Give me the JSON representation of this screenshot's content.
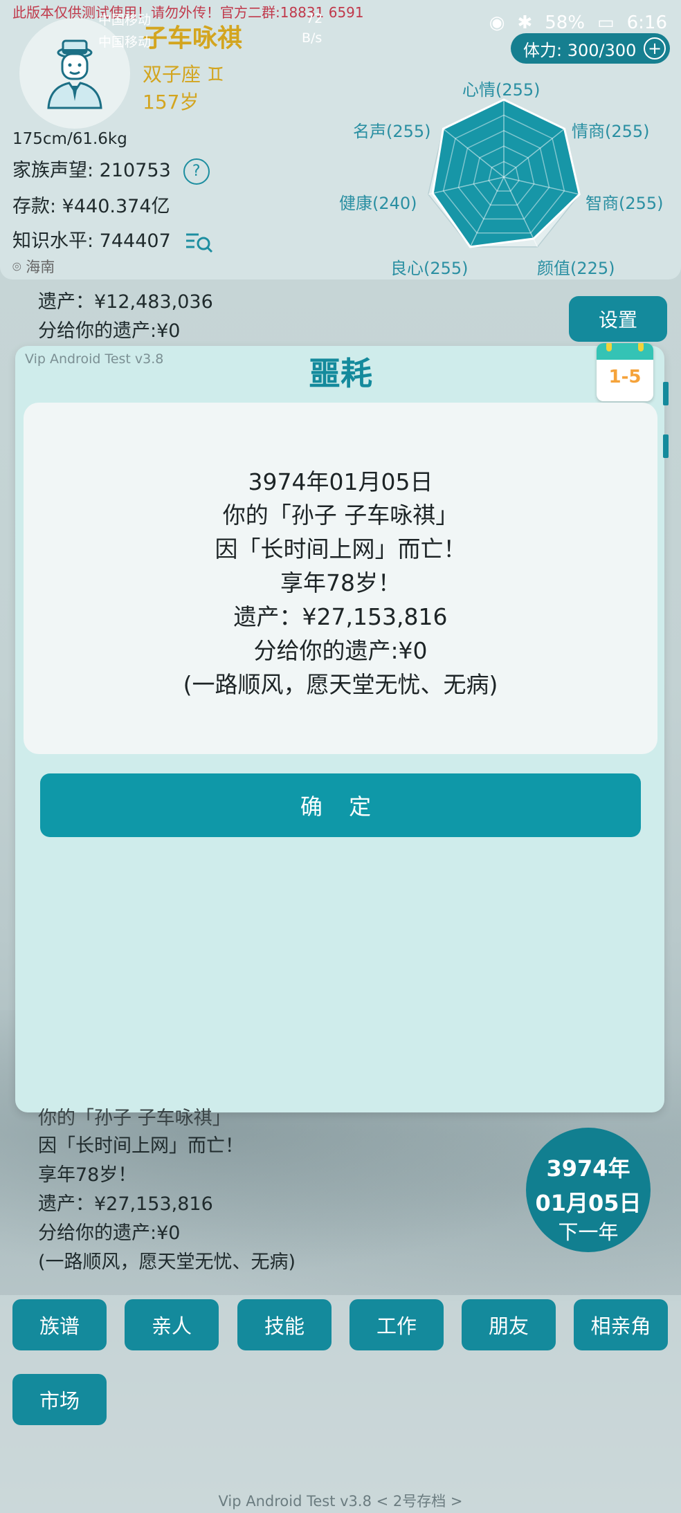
{
  "status_bar": {
    "watermark": "此版本仅供测试使用！请勿外传！官方二群:18831 6591",
    "carrier_1": "中国移动",
    "carrier_2": "中国移动",
    "net_speed": "72",
    "net_unit": "B/s",
    "battery": "58%",
    "time": "6:16"
  },
  "header": {
    "app_title": "子车咏祺",
    "zodiac": "双子座",
    "age": "157岁",
    "height_weight": "175cm/61.6kg",
    "family_reputation": "家族声望: 210753",
    "savings": "存款: ¥440.374亿",
    "knowledge": "知识水平: 744407",
    "location": "海南",
    "stamina": "体力: 300/300"
  },
  "radar": {
    "labels": [
      "心情(255)",
      "情商(255)",
      "智商(255)",
      "颜值(225)",
      "良心(255)",
      "健康(240)",
      "名声(255)"
    ],
    "values": [
      255,
      255,
      255,
      225,
      255,
      240,
      255
    ],
    "max": 255,
    "fill_color": "#1796a7"
  },
  "background_log": {
    "top_lines": [
      "遗产：¥12,483,036",
      "分给你的遗产:¥0"
    ],
    "bottom_lines": [
      "你的「孙子 子车咏祺」",
      "因「长时间上网」而亡！",
      "享年78岁！",
      "遗产：¥27,153,816",
      "分给你的遗产:¥0",
      "(一路顺风，愿天堂无忧、无病)"
    ]
  },
  "settings_label": "设置",
  "modal": {
    "version": "Vip Android Test v3.8",
    "title": "噩耗",
    "calendar": "1-5",
    "lines": [
      "3974年01月05日",
      "你的「孙子 子车咏祺」",
      "因「长时间上网」而亡！",
      "享年78岁！",
      "遗产：¥27,153,816",
      "分给你的遗产:¥0",
      "(一路顺风，愿天堂无忧、无病)"
    ],
    "confirm": "确 定"
  },
  "date_circle": {
    "year": "3974年",
    "date": "01月05日",
    "next": "下一年"
  },
  "menu": [
    "族谱",
    "亲人",
    "技能",
    "工作",
    "朋友",
    "相亲角",
    "市场"
  ],
  "footer": "Vip Android Test v3.8  < 2号存档 >",
  "colors": {
    "accent": "#148a9c",
    "gold": "#d3a51f",
    "watermark": "#c0394b"
  }
}
